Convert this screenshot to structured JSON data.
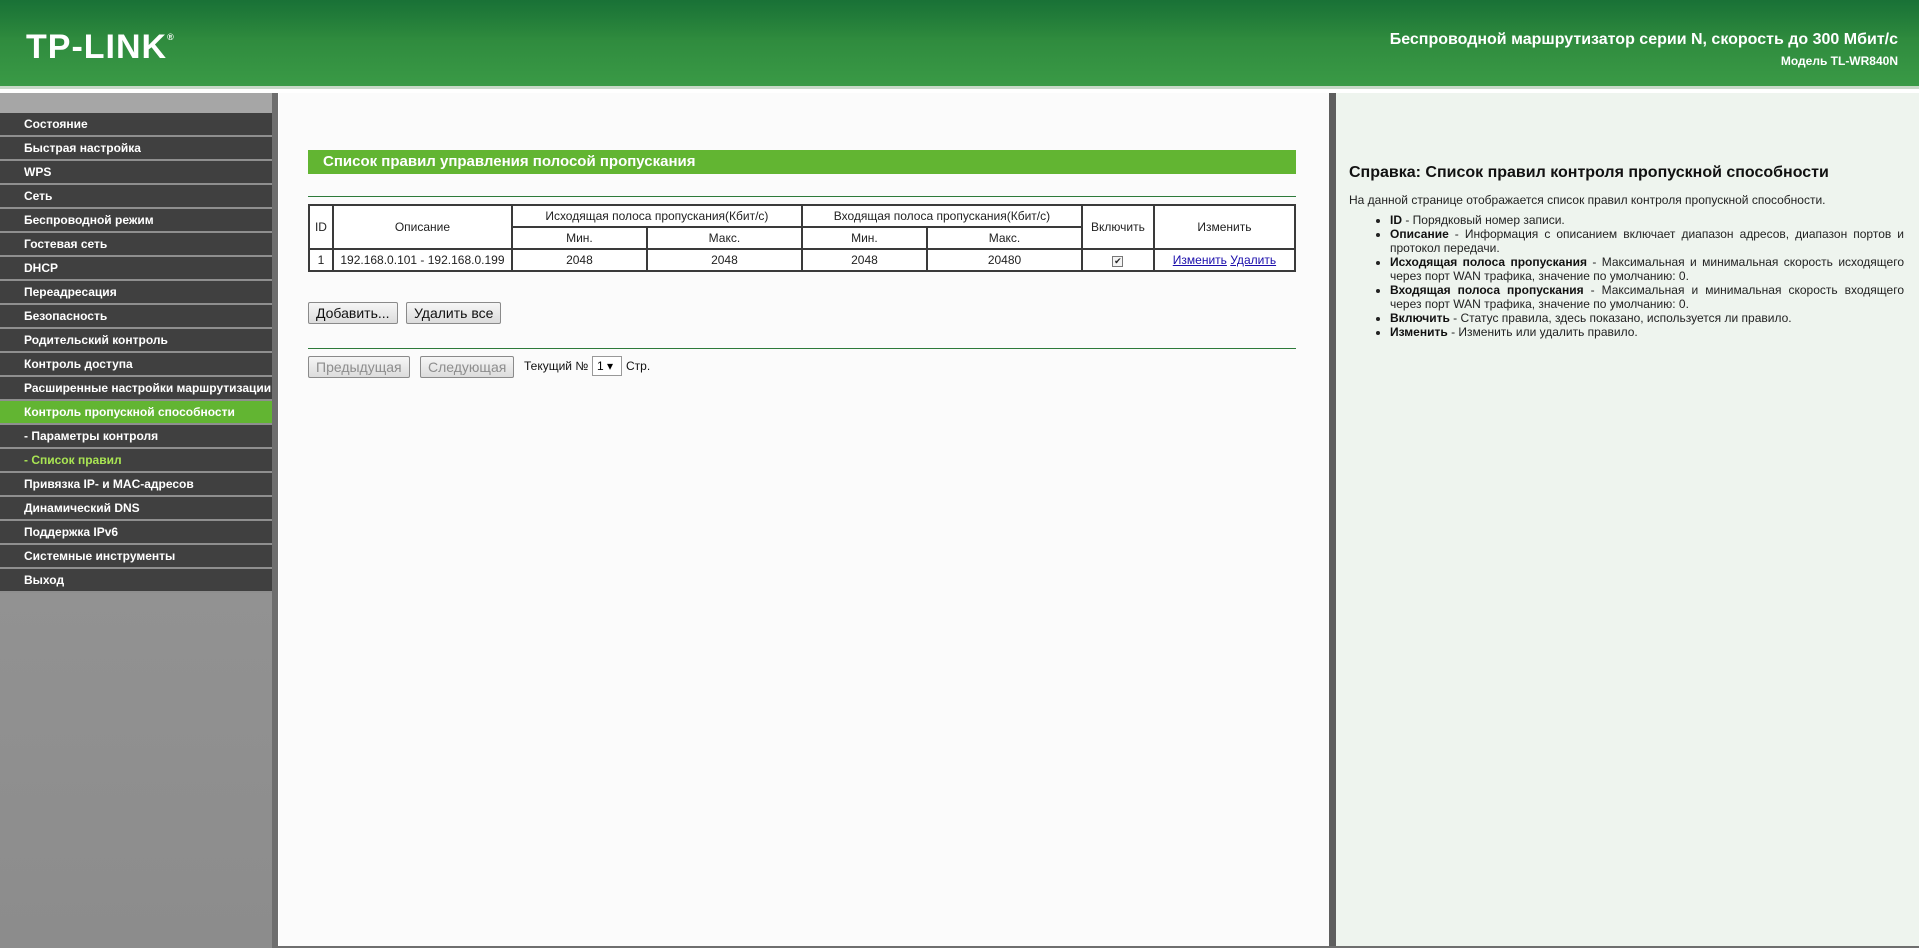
{
  "header": {
    "logo": "TP-LINK",
    "logo_mark": "®",
    "title": "Беспроводной маршрутизатор серии N, скорость до 300 Мбит/с",
    "model": "Модель TL-WR840N"
  },
  "sidebar": {
    "items": [
      {
        "label": "Состояние"
      },
      {
        "label": "Быстрая настройка"
      },
      {
        "label": "WPS"
      },
      {
        "label": "Сеть"
      },
      {
        "label": "Беспроводной режим"
      },
      {
        "label": "Гостевая сеть"
      },
      {
        "label": "DHCP"
      },
      {
        "label": "Переадресация"
      },
      {
        "label": "Безопасность"
      },
      {
        "label": "Родительский контроль"
      },
      {
        "label": "Контроль доступа"
      },
      {
        "label": "Расширенные настройки маршрутизации"
      },
      {
        "label": "Контроль пропускной способности"
      },
      {
        "label": "- Параметры контроля"
      },
      {
        "label": "- Список правил"
      },
      {
        "label": "Привязка IP- и MAC-адресов"
      },
      {
        "label": "Динамический DNS"
      },
      {
        "label": "Поддержка IPv6"
      },
      {
        "label": "Системные инструменты"
      },
      {
        "label": "Выход"
      }
    ]
  },
  "main": {
    "title": "Список правил управления полосой пропускания",
    "table": {
      "h_id": "ID",
      "h_desc": "Описание",
      "h_out": "Исходящая полоса пропускания(Кбит/с)",
      "h_in": "Входящая полоса пропускания(Кбит/с)",
      "h_enable": "Включить",
      "h_edit": "Изменить",
      "h_min": "Мин.",
      "h_max": "Макс.",
      "rows": [
        {
          "id": "1",
          "desc": "192.168.0.101 - 192.168.0.199",
          "out_min": "2048",
          "out_max": "2048",
          "in_min": "2048",
          "in_max": "20480",
          "enabled": "✔",
          "edit": "Изменить",
          "delete": "Удалить"
        }
      ]
    },
    "add_button": "Добавить...",
    "delete_all_button": "Удалить все",
    "prev_button": "Предыдущая",
    "next_button": "Следующая",
    "current_label": "Текущий №",
    "page_value": "1",
    "page_arrow": "▾",
    "page_suffix": "Стр."
  },
  "help": {
    "title": "Справка: Список правил контроля пропускной способности",
    "intro": "На данной странице отображается список правил контроля пропускной способности.",
    "items": [
      {
        "term": "ID",
        "text": " - Порядковый номер записи."
      },
      {
        "term": "Описание",
        "text": " - Информация с описанием включает диапазон адресов, диапазон портов и протокол передачи."
      },
      {
        "term": "Исходящая полоса пропускания",
        "text": " - Максимальная и минимальная скорость исходящего через порт WAN трафика, значение по умолчанию: 0."
      },
      {
        "term": "Входящая полоса пропускания",
        "text": " - Максимальная и минимальная скорость входящего через порт WAN трафика, значение по умолчанию: 0."
      },
      {
        "term": "Включить",
        "text": " - Статус правила, здесь показано, используется ли правило."
      },
      {
        "term": "Изменить",
        "text": " - Изменить или удалить правило."
      }
    ]
  }
}
